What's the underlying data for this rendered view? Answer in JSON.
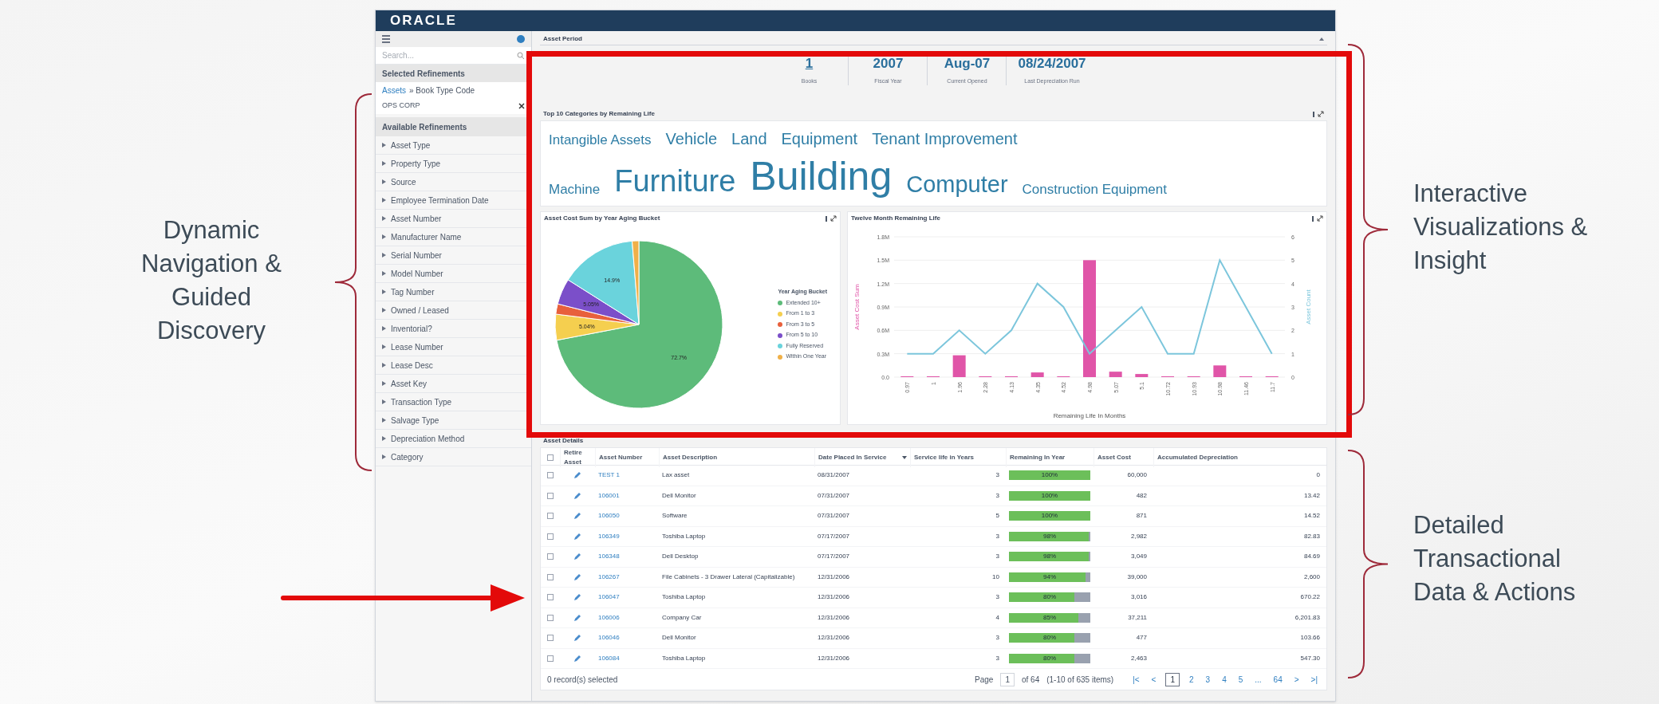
{
  "annotations": [
    {
      "kind": "left",
      "text": "Dynamic Navigation & Guided Discovery"
    },
    {
      "kind": "right-top",
      "text": "Interactive Visualizations & Insight"
    },
    {
      "kind": "right-bottom",
      "text": "Detailed Transactional Data & Actions"
    }
  ],
  "app": {
    "logo": "ORACLE",
    "sidebar": {
      "search_placeholder": "Search...",
      "selected_heading": "Selected Refinements",
      "breadcrumb_link": "Assets",
      "breadcrumb_rest": "» Book Type Code",
      "selected_value": "OPS CORP",
      "available_heading": "Available Refinements",
      "refinements": [
        "Asset Type",
        "Property Type",
        "Source",
        "Employee Termination Date",
        "Asset Number",
        "Manufacturer Name",
        "Serial Number",
        "Model Number",
        "Tag Number",
        "Owned / Leased",
        "Inventorial?",
        "Lease Number",
        "Lease Desc",
        "Asset Key",
        "Transaction Type",
        "Salvage Type",
        "Depreciation Method",
        "Category"
      ]
    },
    "asset_period": {
      "title": "Asset Period",
      "stats": [
        {
          "kind": "link",
          "value": "1",
          "label": "Books"
        },
        {
          "kind": "plain",
          "value": "2007",
          "label": "Fiscal Year"
        },
        {
          "kind": "plain",
          "value": "Aug-07",
          "label": "Current Opened"
        },
        {
          "kind": "plain",
          "value": "08/24/2007",
          "label": "Last Depreciation Run"
        }
      ]
    },
    "top_categories": {
      "title": "Top 10 Categories by Remaining Life",
      "words": [
        {
          "text": "Intangible Assets",
          "kind": "s"
        },
        {
          "text": "Vehicle",
          "kind": "m"
        },
        {
          "text": "Land",
          "kind": "m"
        },
        {
          "text": "Equipment",
          "kind": "m"
        },
        {
          "text": "Tenant Improvement",
          "kind": "m"
        },
        {
          "text": "Machine",
          "kind": "s"
        },
        {
          "text": "Furniture",
          "kind": "xl"
        },
        {
          "text": "Building",
          "kind": "xxl"
        },
        {
          "text": "Computer",
          "kind": "l"
        },
        {
          "text": "Construction Equipment",
          "kind": "s"
        }
      ]
    },
    "pie_panel": {
      "title": "Asset Cost Sum by Year Aging Bucket",
      "chart_data": {
        "type": "pie",
        "legend": {
          "title": "Year Aging Bucket"
        },
        "categories": [
          "Extended 10+",
          "From 1 to 3",
          "From 3 to 5",
          "From 5 to 10",
          "Fully Reserved",
          "Within One Year"
        ],
        "colors": [
          "#5dbb7a",
          "#f5cf4f",
          "#e8603c",
          "#7b4fc9",
          "#6ad3dc",
          "#f0b048"
        ],
        "values": [
          72.7,
          5.04,
          2.0,
          5.05,
          14.9,
          1.3
        ],
        "value_labels": [
          "72.7%",
          "5.04%",
          null,
          "5.05%",
          "14.9%",
          null
        ]
      }
    },
    "line_panel": {
      "title": "Twelve Month Remaining Life",
      "chart_data": {
        "type": "bar",
        "xlabel": "Remaining Life In Months",
        "grid": true,
        "categories": [
          "0.97",
          "1",
          "1.96",
          "2.28",
          "4.13",
          "4.35",
          "4.52",
          "4.98",
          "5.07",
          "5.1",
          "10.72",
          "10.93",
          "10.98",
          "11.46",
          "11.7"
        ],
        "series": [
          {
            "name": "Asset Cost Sum",
            "type": "bar",
            "color": "#e055a8",
            "values": [
              0.01,
              0.01,
              0.28,
              0.0,
              0.01,
              0.06,
              0.01,
              1.5,
              0.07,
              0.04,
              0.0,
              0.0,
              0.15,
              0.0,
              0.0
            ]
          },
          {
            "name": "Asset Count",
            "type": "line",
            "axis": "y2",
            "color": "#7cc6dc",
            "values": [
              1,
              1,
              2,
              1,
              2,
              4,
              3,
              1,
              2,
              3,
              1,
              1,
              5,
              3,
              1
            ]
          }
        ],
        "ylim": [
          0,
          1.8
        ],
        "yticks": [
          {
            "value": 0,
            "label": "0.0"
          },
          {
            "value": 0.3,
            "label": "0.3M"
          },
          {
            "value": 0.6,
            "label": "0.6M"
          },
          {
            "value": 0.9,
            "label": "0.9M"
          },
          {
            "value": 1.2,
            "label": "1.2M"
          },
          {
            "value": 1.5,
            "label": "1.5M"
          },
          {
            "value": 1.8,
            "label": "1.8M"
          }
        ],
        "y2lim": [
          0,
          6
        ],
        "y2ticks": [
          0,
          1,
          2,
          3,
          4,
          5,
          6
        ]
      }
    },
    "details": {
      "title": "Asset Details",
      "all_selected": false,
      "columns": [
        {
          "label": "Retire Asset",
          "sorted": false
        },
        {
          "label": "Asset Number",
          "sorted": false
        },
        {
          "label": "Asset Description",
          "sorted": false
        },
        {
          "label": "Date Placed In Service",
          "sorted": true
        },
        {
          "label": "Service life in Years",
          "sorted": false
        },
        {
          "label": "Remaining In Year",
          "sorted": false
        },
        {
          "label": "Asset Cost",
          "sorted": false
        },
        {
          "label": "Accumulated Depreciation",
          "sorted": false
        }
      ],
      "rows": [
        {
          "selected": false,
          "number": "TEST 1",
          "description": "Lax asset",
          "date": "08/31/2007",
          "life": "3",
          "remaining": "100%",
          "level": 1.0,
          "cost": "60,000",
          "depreciation": "0"
        },
        {
          "selected": false,
          "number": "106001",
          "description": "Dell Monitor",
          "date": "07/31/2007",
          "life": "3",
          "remaining": "100%",
          "level": 1.0,
          "cost": "482",
          "depreciation": "13.42"
        },
        {
          "selected": false,
          "number": "106050",
          "description": "Software",
          "date": "07/31/2007",
          "life": "5",
          "remaining": "100%",
          "level": 1.0,
          "cost": "871",
          "depreciation": "14.52"
        },
        {
          "selected": false,
          "number": "106349",
          "description": "Toshiba Laptop",
          "date": "07/17/2007",
          "life": "3",
          "remaining": "98%",
          "level": 0.98,
          "cost": "2,982",
          "depreciation": "82.83"
        },
        {
          "selected": false,
          "number": "106348",
          "description": "Dell Desktop",
          "date": "07/17/2007",
          "life": "3",
          "remaining": "98%",
          "level": 0.98,
          "cost": "3,049",
          "depreciation": "84.69"
        },
        {
          "selected": false,
          "number": "106267",
          "description": "File Cabinets - 3 Drawer Lateral (Capitalizable)",
          "date": "12/31/2006",
          "life": "10",
          "remaining": "94%",
          "level": 0.94,
          "cost": "39,000",
          "depreciation": "2,600"
        },
        {
          "selected": false,
          "number": "106047",
          "description": "Toshiba Laptop",
          "date": "12/31/2006",
          "life": "3",
          "remaining": "80%",
          "level": 0.8,
          "cost": "3,016",
          "depreciation": "670.22"
        },
        {
          "selected": false,
          "number": "106006",
          "description": "Company Car",
          "date": "12/31/2006",
          "life": "4",
          "remaining": "85%",
          "level": 0.85,
          "cost": "37,211",
          "depreciation": "6,201.83"
        },
        {
          "selected": false,
          "number": "106046",
          "description": "Dell Monitor",
          "date": "12/31/2006",
          "life": "3",
          "remaining": "80%",
          "level": 0.8,
          "cost": "477",
          "depreciation": "103.66"
        },
        {
          "selected": false,
          "number": "106084",
          "description": "Toshiba Laptop",
          "date": "12/31/2006",
          "life": "3",
          "remaining": "80%",
          "level": 0.8,
          "cost": "2,463",
          "depreciation": "547.30"
        }
      ],
      "selection_status": "0 record(s) selected",
      "page_label": "Page",
      "page_value": "1",
      "page_of": "of 64",
      "items_info": "(1-10 of 635 items)",
      "pages": [
        {
          "label": "|<",
          "selected": false
        },
        {
          "label": "<",
          "selected": false
        },
        {
          "label": "1",
          "selected": true
        },
        {
          "label": "2",
          "selected": false
        },
        {
          "label": "3",
          "selected": false
        },
        {
          "label": "4",
          "selected": false
        },
        {
          "label": "5",
          "selected": false
        },
        {
          "label": "...",
          "selected": false
        },
        {
          "label": "64",
          "selected": false
        },
        {
          "label": ">",
          "selected": false
        },
        {
          "label": ">|",
          "selected": false
        }
      ]
    }
  }
}
